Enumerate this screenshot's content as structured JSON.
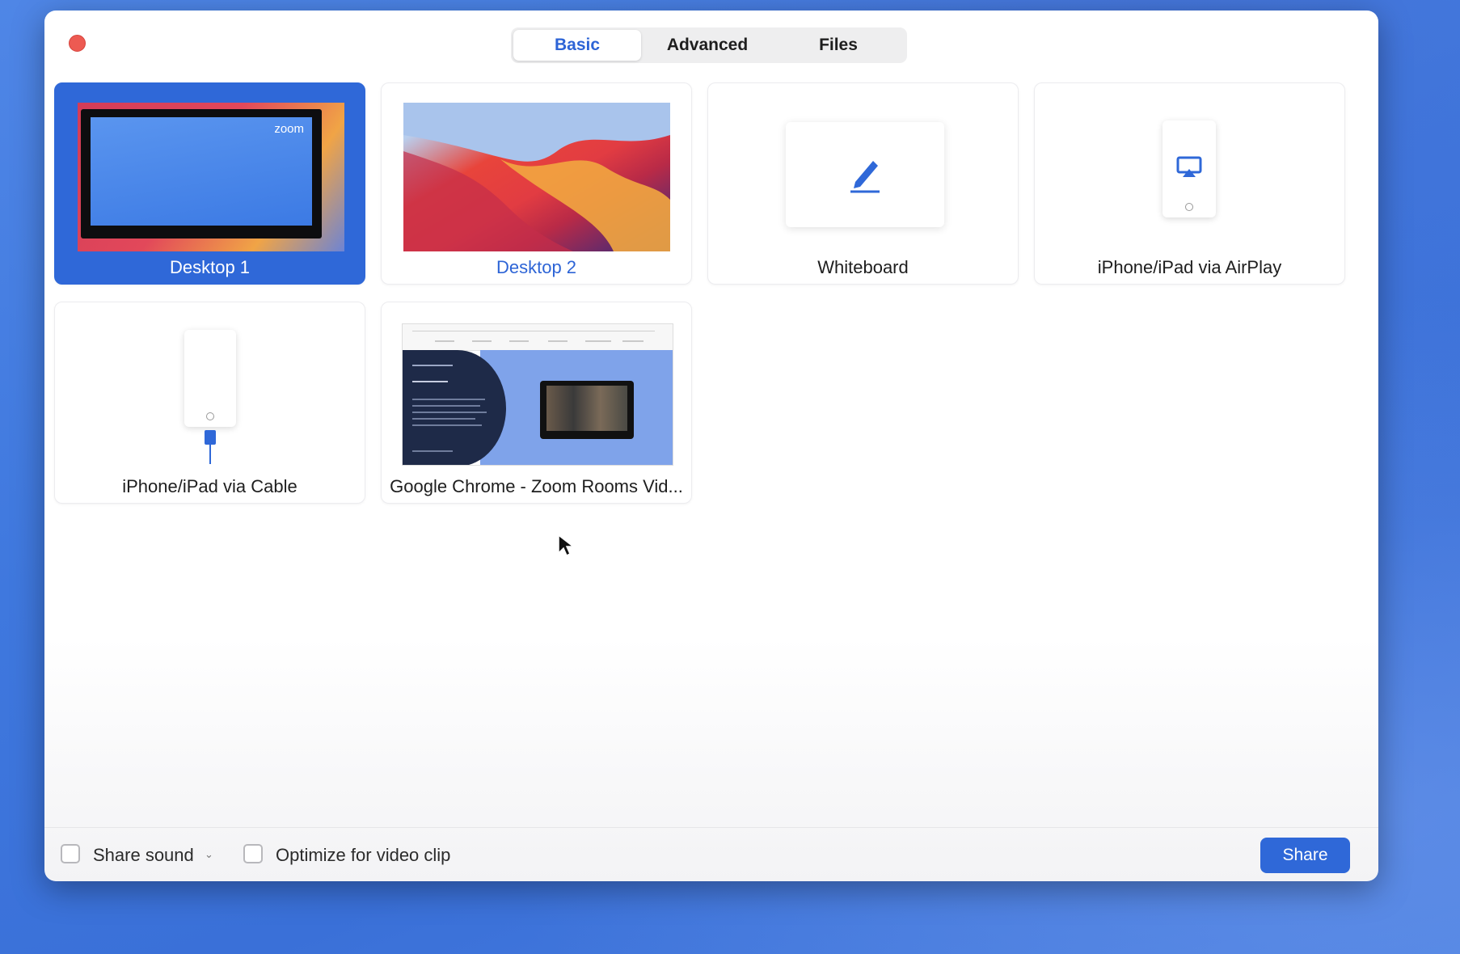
{
  "tabs": [
    {
      "label": "Basic",
      "active": true
    },
    {
      "label": "Advanced",
      "active": false
    },
    {
      "label": "Files",
      "active": false
    }
  ],
  "sources": [
    {
      "label": "Desktop 1",
      "selected": true
    },
    {
      "label": "Desktop 2",
      "selected": false
    },
    {
      "label": "Whiteboard",
      "selected": false
    },
    {
      "label": "iPhone/iPad via AirPlay",
      "selected": false
    },
    {
      "label": "iPhone/iPad via Cable",
      "selected": false
    },
    {
      "label": "Google Chrome - Zoom Rooms Vid...",
      "selected": false
    }
  ],
  "thumbnail_text": {
    "zoom_logo": "zoom"
  },
  "options": {
    "share_sound_label": "Share sound",
    "share_sound_checked": false,
    "optimize_label": "Optimize for video clip",
    "optimize_checked": false
  },
  "share_button_label": "Share",
  "colors": {
    "accent": "#2f68d8",
    "close": "#ed5a52",
    "desktop_bg": "#3f78de"
  },
  "icons": [
    "close-icon",
    "pencil-icon",
    "airplay-icon",
    "cable-icon",
    "chevron-down-icon",
    "cursor-icon"
  ]
}
